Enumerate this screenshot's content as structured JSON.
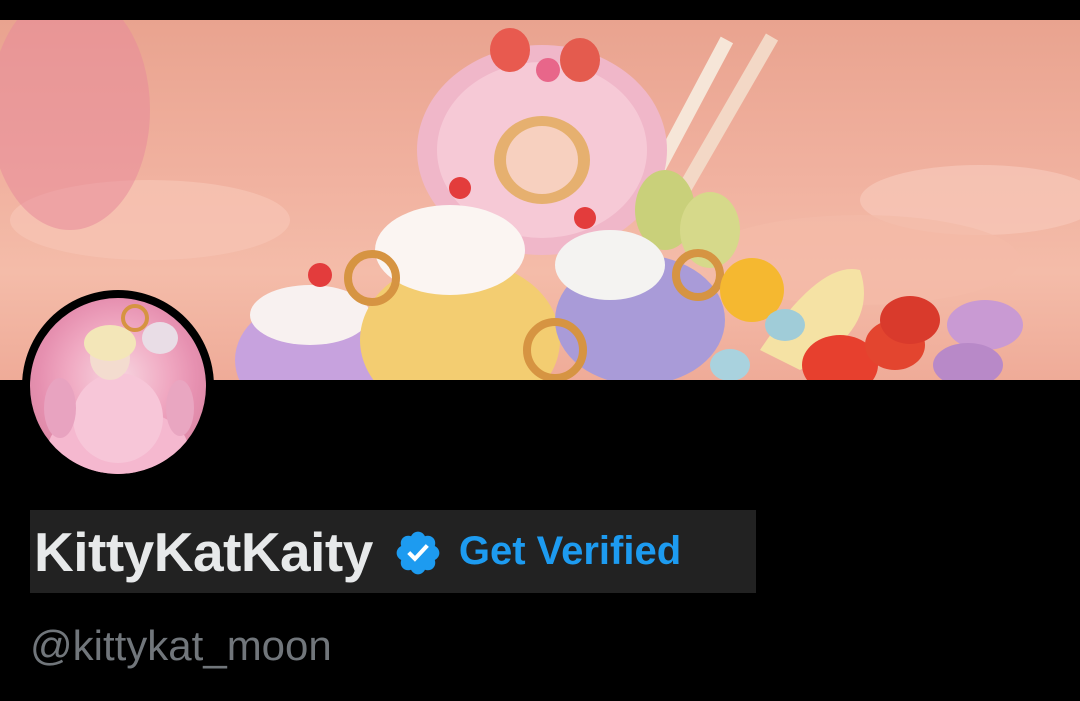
{
  "profile": {
    "display_name": "KittyKatKaity",
    "verified_badge_icon": "verified-badge-icon",
    "get_verified_label": "Get Verified",
    "handle": "@kittykat_moon"
  },
  "colors": {
    "background": "#000000",
    "name_highlight": "#222222",
    "name_text": "#e7e9ea",
    "accent_blue": "#1d9bf0",
    "handle_text": "#71767b"
  }
}
